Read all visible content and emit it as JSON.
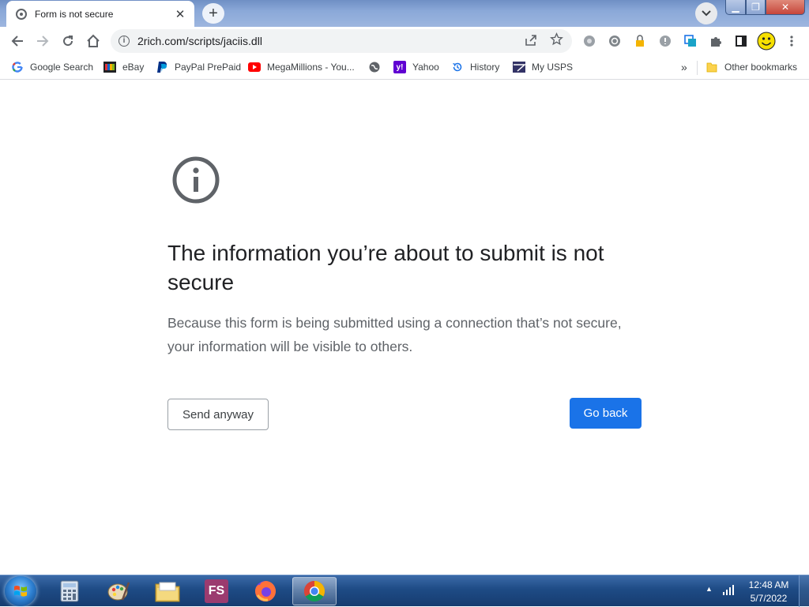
{
  "tab": {
    "title": "Form is not secure",
    "close_label": "✕"
  },
  "newtab": {
    "label": "+"
  },
  "tabsearch": {
    "label": "⌄"
  },
  "window": {
    "minimize": "▁",
    "maximize": "❐",
    "close": "✕"
  },
  "nav": {
    "back": "←",
    "forward": "→",
    "reload": "↻",
    "home": "⌂"
  },
  "omnibox": {
    "url": "2rich.com/scripts/jaciis.dll",
    "info": "i"
  },
  "bookmarks": [
    {
      "label": "Google Search",
      "icon": "google-icon"
    },
    {
      "label": "eBay",
      "icon": "ebay-icon"
    },
    {
      "label": "PayPal PrePaid",
      "icon": "paypal-icon"
    },
    {
      "label": "MegaMillions - You...",
      "icon": "youtube-icon"
    },
    {
      "label": "",
      "icon": "globe-icon"
    },
    {
      "label": "Yahoo",
      "icon": "yahoo-icon"
    },
    {
      "label": "History",
      "icon": "history-icon"
    },
    {
      "label": "My USPS",
      "icon": "usps-icon"
    }
  ],
  "bookmarks_more": "»",
  "other_bookmarks": "Other bookmarks",
  "interstitial": {
    "heading": "The information you’re about to submit is not secure",
    "body": "Because this form is being submitted using a connection that’s not secure, your information will be visible to others.",
    "send_anyway": "Send anyway",
    "go_back": "Go back",
    "primary_color": "#1a73e8"
  },
  "taskbar": {
    "apps": [
      "calculator",
      "paint",
      "file-explorer",
      "fs-app",
      "firefox",
      "chrome"
    ],
    "fs_label": "FS",
    "tray_arrow": "▲",
    "time": "12:48 AM",
    "date": "5/7/2022"
  }
}
